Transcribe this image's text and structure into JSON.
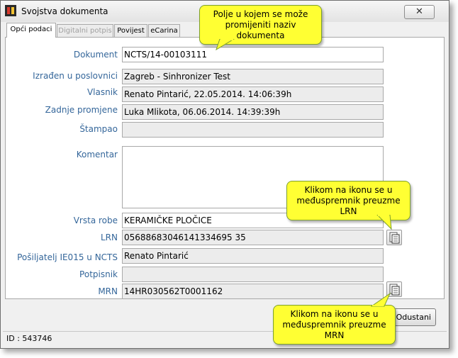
{
  "window": {
    "title": "Svojstva dokumenta",
    "close_glyph": "✕"
  },
  "tabs": [
    {
      "label": "Opći podaci",
      "state": "active"
    },
    {
      "label": "Digitalni potpis",
      "state": "disabled"
    },
    {
      "label": "Povijest",
      "state": "normal"
    },
    {
      "label": "eCarina",
      "state": "normal"
    }
  ],
  "form": {
    "dokument": {
      "label": "Dokument",
      "value": "NCTS/14-00103111"
    },
    "izraden": {
      "label": "Izrađen u poslovnici",
      "value": "Zagreb - Sinhronizer Test"
    },
    "vlasnik": {
      "label": "Vlasnik",
      "value": "Renato Pintarić, 22.05.2014. 14:06:39h"
    },
    "zadnje": {
      "label": "Zadnje promjene",
      "value": "Luka Mlikota, 06.06.2014. 14:39:39h"
    },
    "stampao": {
      "label": "Štampao",
      "value": ""
    },
    "komentar": {
      "label": "Komentar",
      "value": ""
    },
    "vrsta": {
      "label": "Vrsta robe",
      "value": "KERAMIČKE PLOČICE"
    },
    "lrn": {
      "label": "LRN",
      "value": "05688683046141334695 35"
    },
    "posiljatelj": {
      "label": "Pošiljatelj IE015 u NCTS",
      "value": "Renato Pintarić"
    },
    "potpisnik": {
      "label": "Potpisnik",
      "value": ""
    },
    "mrn": {
      "label": "MRN",
      "value": "14HR030562T0001162"
    }
  },
  "buttons": {
    "odustani": "Odustani"
  },
  "status": {
    "id_text": "ID : 543746"
  },
  "callouts": {
    "naziv": "Polje u kojem se može promijeniti naziv dokumenta",
    "lrn": "Klikom na ikonu se u međuspremnik preuzme LRN",
    "mrn": "Klikom na ikonu se u međuspremnik preuzme MRN"
  },
  "colors": {
    "label": "#34669a",
    "callout_fill": "#ffff33",
    "callout_border": "#7d9f2d"
  },
  "icons": {
    "app": "app-logo-icon",
    "copy": "copy-to-clipboard-icon",
    "close": "close-icon"
  }
}
